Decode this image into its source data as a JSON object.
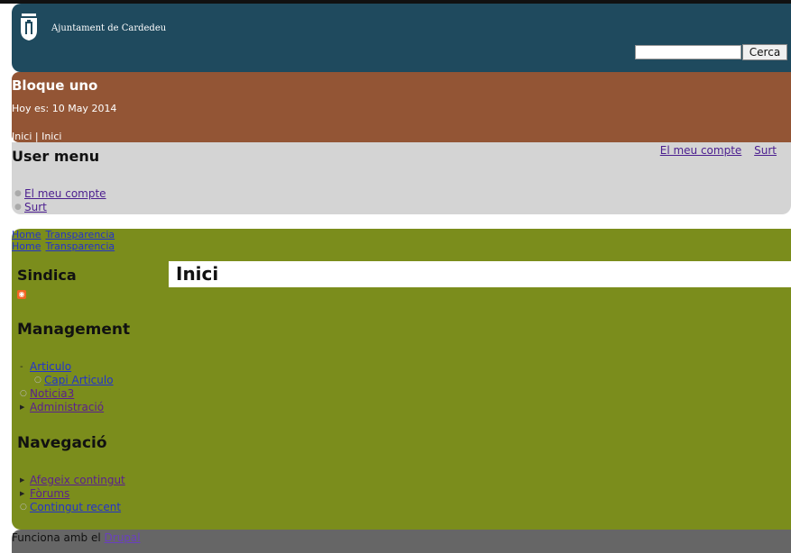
{
  "header": {
    "site_name": "Ajuntament de Cardedeu",
    "search_placeholder": "",
    "search_button": "Cerca"
  },
  "bloque": {
    "title": "Bloque uno",
    "date_text": "Hoy es: 10 May 2014",
    "breadcrumb": "Inici | Inici"
  },
  "user_menu": {
    "title": "User menu",
    "top_links": [
      "El meu compte",
      "Surt"
    ],
    "items": [
      "El meu compte",
      "Surt"
    ]
  },
  "breadcrumbs": [
    [
      "Home",
      "Transparencia"
    ],
    [
      "Home",
      "Transparencia"
    ]
  ],
  "sindica": {
    "title": "Sindica"
  },
  "management": {
    "title": "Management",
    "items": [
      "Articulo",
      "Capi Articulo",
      "Noticia3",
      "Administració"
    ]
  },
  "navigacio": {
    "title": "Navegació",
    "items": [
      "Afegeix contingut",
      "Fòrums",
      "Contingut recent"
    ]
  },
  "content": {
    "title": "Inici"
  },
  "footer": {
    "text": "Funciona amb el ",
    "link": "Drupal"
  },
  "colors": {
    "header": "#1f4a5e",
    "bloque": "#935535",
    "user_menu": "#d4d4d4",
    "main": "#7b8d1c",
    "footer": "#666666"
  }
}
